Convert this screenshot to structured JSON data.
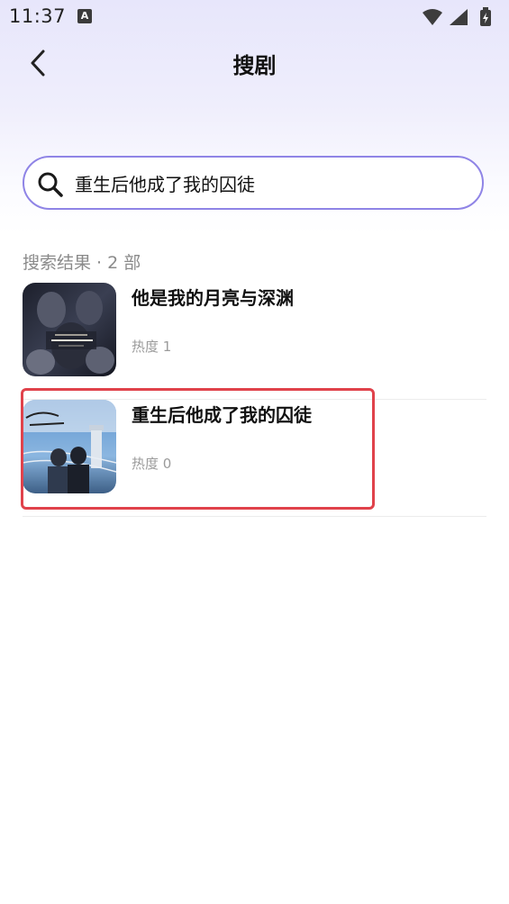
{
  "status_bar": {
    "time": "11:37",
    "notification_badge": "A"
  },
  "header": {
    "title": "搜剧",
    "back_icon": "chevron-left-icon"
  },
  "search": {
    "value": "重生后他成了我的囚徒",
    "icon": "search-icon",
    "border_color": "#8f84e6"
  },
  "results": {
    "label": "搜索结果 · 2 部",
    "items": [
      {
        "title": "他是我的月亮与深渊",
        "heat": "热度 1"
      },
      {
        "title": "重生后他成了我的囚徒",
        "heat": "热度 0"
      }
    ]
  },
  "colors": {
    "highlight": "#e0424b",
    "accent": "#8f84e6"
  }
}
